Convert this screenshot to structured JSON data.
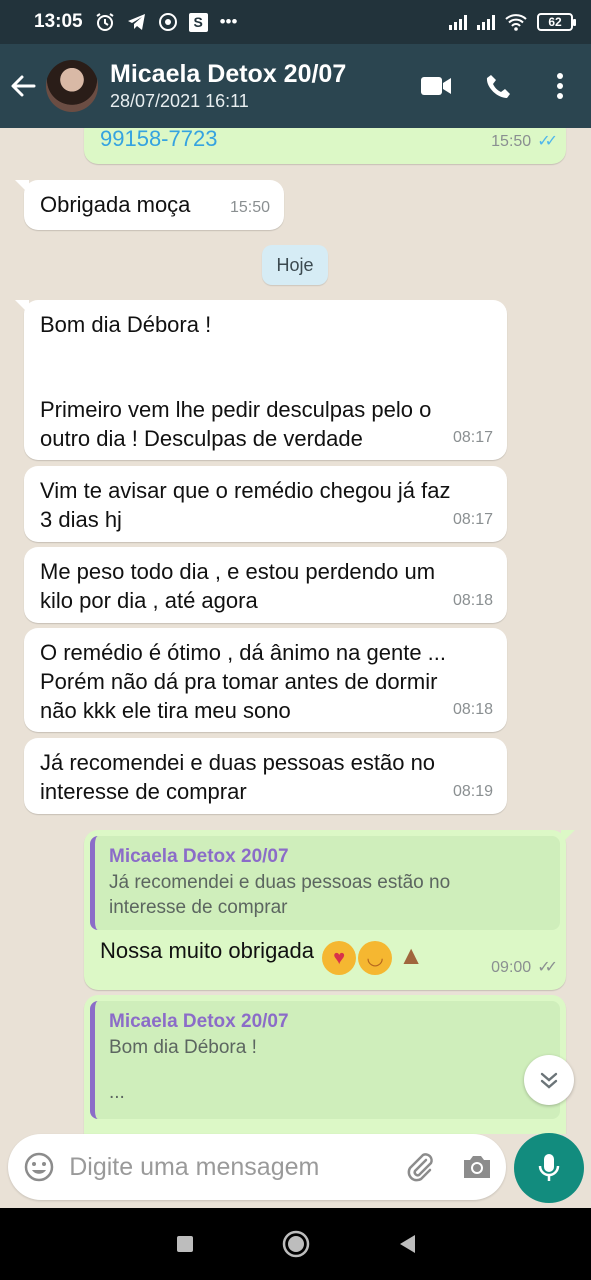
{
  "status_bar": {
    "time": "13:05",
    "battery": "62",
    "icons": [
      "alarm-icon",
      "telegram-icon",
      "shield-icon",
      "s-app-icon",
      "more-dots-icon",
      "signal-icon",
      "signal-icon",
      "wifi-icon",
      "battery-icon"
    ]
  },
  "header": {
    "contact_name": "Micaela Detox 20/07",
    "subtitle": "28/07/2021 16:11"
  },
  "chat": {
    "day_chip": "Hoje",
    "messages": [
      {
        "dir": "out",
        "text": "99158-7723",
        "time": "15:50",
        "status": "read"
      },
      {
        "dir": "in",
        "text": "Obrigada moça",
        "time": "15:50"
      },
      {
        "dir": "in",
        "line1": "Bom dia Débora !",
        "line2": "Primeiro vem lhe pedir desculpas pelo o",
        "line3": "outro dia !  Desculpas de verdade",
        "time": "08:17"
      },
      {
        "dir": "in",
        "line1": "Vim te avisar que o remédio chegou já faz",
        "line2": "3 dias hj",
        "time": "08:17"
      },
      {
        "dir": "in",
        "line1": "Me peso todo dia , e estou perdendo um",
        "line2": "kilo por dia , até agora",
        "time": "08:18"
      },
      {
        "dir": "in",
        "line1": "O remédio é ótimo , dá ânimo na gente ...",
        "line2": "Porém não dá pra tomar antes de dormir",
        "line3": "não kkk ele tira meu sono",
        "time": "08:18"
      },
      {
        "dir": "in",
        "line1": "Já recomendei e duas pessoas estão no",
        "line2": "interesse de comprar",
        "time": "08:19"
      },
      {
        "dir": "out",
        "quote_name": "Micaela Detox 20/07",
        "quote_line1": "Já recomendei e duas pessoas estão no",
        "quote_line2": "interesse de comprar",
        "text": "Nossa muito obrigada",
        "emojis": [
          "smiling-face-with-hearts-emoji",
          "smiling-face-emoji",
          "folded-hands-emoji"
        ],
        "time": "09:00",
        "status": "delivered"
      },
      {
        "dir": "out",
        "quote_name": "Micaela Detox 20/07",
        "quote_line1": "Bom dia Débora !",
        "quote_line2": "...",
        "partial": true
      }
    ]
  },
  "composer": {
    "placeholder": "Digite uma mensagem"
  },
  "colors": {
    "header_bg": "#2b4550",
    "status_bar_bg": "#22333b",
    "outgoing_bubble": "#dcf8c6",
    "incoming_bubble": "#ffffff",
    "accent_green": "#128c7e",
    "read_ticks": "#4fb6ec",
    "quote_accent": "#8b6cc8"
  }
}
